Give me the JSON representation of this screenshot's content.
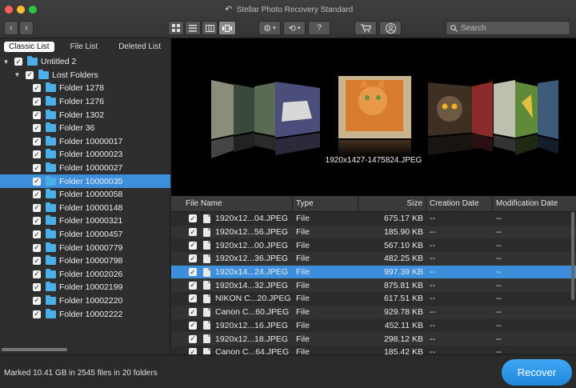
{
  "window": {
    "title": "Stellar Photo Recovery Standard",
    "traffic_lights": [
      "close",
      "minimize",
      "zoom"
    ]
  },
  "toolbar": {
    "nav_back_icon": "chevron-left-icon",
    "nav_forward_icon": "chevron-right-icon",
    "views": [
      "grid-view-icon",
      "list-view-icon",
      "column-view-icon",
      "coverflow-view-icon"
    ],
    "active_view": "coverflow-view-icon",
    "settings_icon": "gear-icon",
    "history_icon": "history-icon",
    "help_label": "?",
    "cart_icon": "cart-icon",
    "user_icon": "user-icon",
    "search_placeholder": "Search"
  },
  "sidebar": {
    "tabs": [
      {
        "label": "Classic List",
        "active": true
      },
      {
        "label": "File List",
        "active": false
      },
      {
        "label": "Deleted List",
        "active": false
      }
    ],
    "root": {
      "label": "Untitled 2"
    },
    "group": {
      "label": "Lost Folders"
    },
    "folders": [
      {
        "label": "Folder 1278"
      },
      {
        "label": "Folder 1276"
      },
      {
        "label": "Folder 1302"
      },
      {
        "label": "Folder 36"
      },
      {
        "label": "Folder 10000017"
      },
      {
        "label": "Folder 10000023"
      },
      {
        "label": "Folder 10000027"
      },
      {
        "label": "Folder 10000035",
        "selected": true
      },
      {
        "label": "Folder 10000058"
      },
      {
        "label": "Folder 10000148"
      },
      {
        "label": "Folder 10000321"
      },
      {
        "label": "Folder 10000457"
      },
      {
        "label": "Folder 10000779"
      },
      {
        "label": "Folder 10000798"
      },
      {
        "label": "Folder 10002026"
      },
      {
        "label": "Folder 10002199"
      },
      {
        "label": "Folder 10002220"
      },
      {
        "label": "Folder 10002222"
      }
    ]
  },
  "preview": {
    "caption": "1920x1427-1475824.JPEG"
  },
  "table": {
    "columns": [
      "File Name",
      "Type",
      "Size",
      "Creation Date",
      "Modification Date"
    ],
    "rows": [
      {
        "name": "1920x12...04.JPEG",
        "type": "File",
        "size": "675.17 KB",
        "created": "--",
        "modified": "--"
      },
      {
        "name": "1920x12...56.JPEG",
        "type": "File",
        "size": "185.90 KB",
        "created": "--",
        "modified": "--"
      },
      {
        "name": "1920x12...00.JPEG",
        "type": "File",
        "size": "567.10 KB",
        "created": "--",
        "modified": "--"
      },
      {
        "name": "1920x12...36.JPEG",
        "type": "File",
        "size": "482.25 KB",
        "created": "--",
        "modified": "--"
      },
      {
        "name": "1920x14...24.JPEG",
        "type": "File",
        "size": "997.39 KB",
        "created": "--",
        "modified": "--",
        "selected": true
      },
      {
        "name": "1920x14...32.JPEG",
        "type": "File",
        "size": "875.81 KB",
        "created": "--",
        "modified": "--"
      },
      {
        "name": "NIKON C...20.JPEG",
        "type": "File",
        "size": "617.51 KB",
        "created": "--",
        "modified": "--"
      },
      {
        "name": "Canon C...60.JPEG",
        "type": "File",
        "size": "929.78 KB",
        "created": "--",
        "modified": "--"
      },
      {
        "name": "1920x12...16.JPEG",
        "type": "File",
        "size": "452.11 KB",
        "created": "--",
        "modified": "--"
      },
      {
        "name": "1920x12...18.JPEG",
        "type": "File",
        "size": "298.12 KB",
        "created": "--",
        "modified": "--"
      },
      {
        "name": "Canon C...64.JPEG",
        "type": "File",
        "size": "185.42 KB",
        "created": "--",
        "modified": "--"
      }
    ]
  },
  "status": {
    "text": "Marked 10.41 GB in 2545 files in 20 folders",
    "recover_label": "Recover"
  },
  "colors": {
    "accent": "#3d8fdb",
    "recover_button": "#2a96e8",
    "folder": "#4bb0ea"
  }
}
